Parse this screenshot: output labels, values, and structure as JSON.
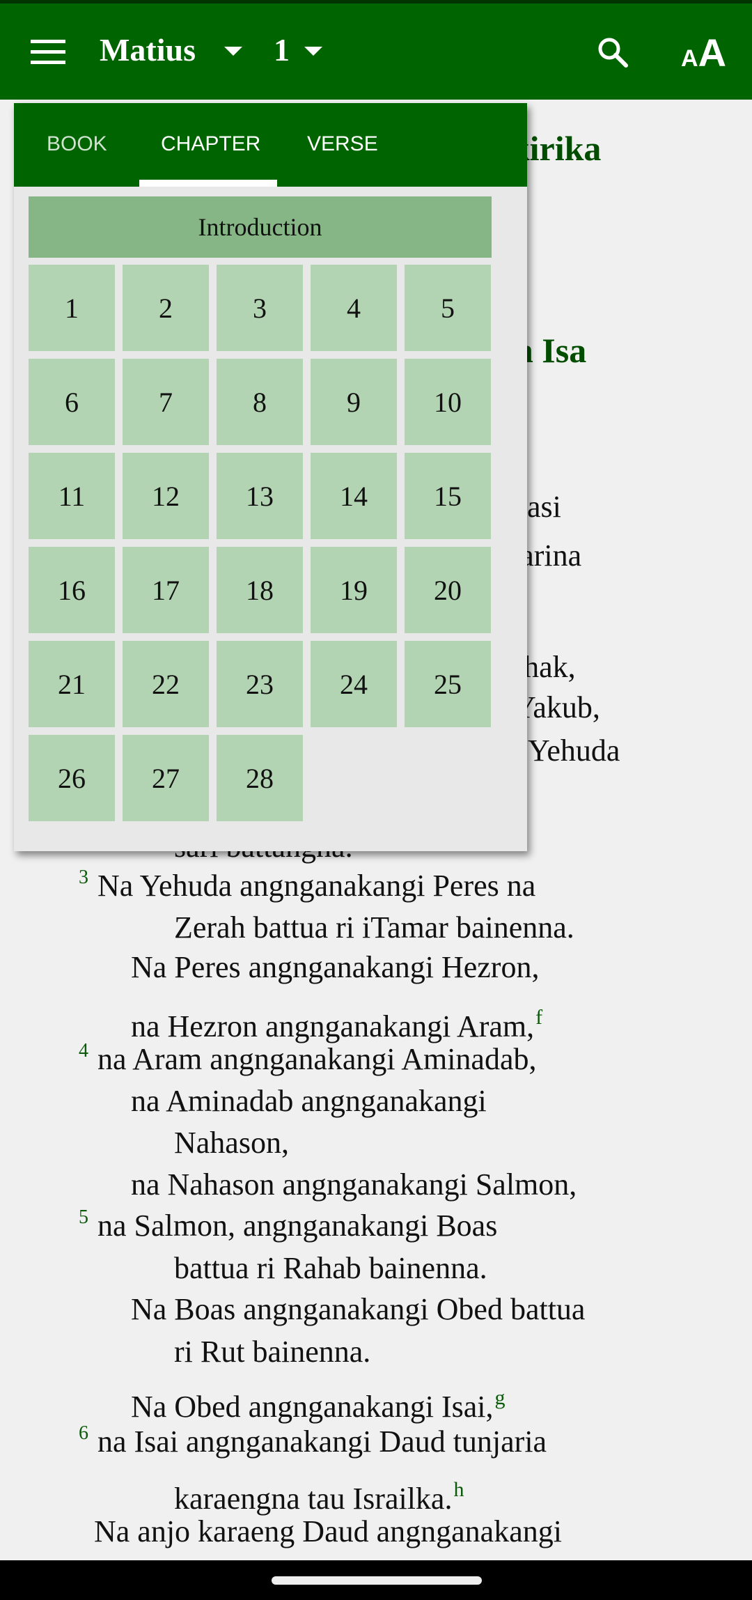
{
  "app_bar": {
    "book": "Matius",
    "chapter": "1",
    "search_icon": "search-icon",
    "text_size_icon": "text-size-icon",
    "text_size_label": "AA"
  },
  "background_fragments": {
    "heading1": "ukirika",
    "heading2a": "a",
    "heading2b": "n Isa",
    "l1": "nasi",
    "l2": "jarina",
    "l3": "shak,",
    "l4": "Yakub,",
    "l5": "Yehuda",
    "l6": "sari battangna."
  },
  "picker": {
    "tabs": [
      {
        "label": "BOOK"
      },
      {
        "label": "CHAPTER"
      },
      {
        "label": "VERSE"
      }
    ],
    "active_tab": "CHAPTER",
    "introduction": "Introduction",
    "chapters": [
      "1",
      "2",
      "3",
      "4",
      "5",
      "6",
      "7",
      "8",
      "9",
      "10",
      "11",
      "12",
      "13",
      "14",
      "15",
      "16",
      "17",
      "18",
      "19",
      "20",
      "21",
      "22",
      "23",
      "24",
      "25",
      "26",
      "27",
      "28"
    ]
  },
  "verses": [
    {
      "num": "3",
      "text": "Na Yehuda angnganakangi Peres na",
      "fn": "",
      "indent": 0
    },
    {
      "num": "",
      "text": "Zerah battua ri iTamar bainenna.",
      "fn": "",
      "indent": 2
    },
    {
      "num": "",
      "text": "Na Peres angnganakangi Hezron,",
      "fn": "",
      "indent": 1
    },
    {
      "num": "",
      "text": "na Hezron angnganakangi Aram,",
      "fn": "f",
      "indent": 1
    },
    {
      "num": "4",
      "text": "na Aram angnganakangi Aminadab,",
      "fn": "",
      "indent": 0
    },
    {
      "num": "",
      "text": "na Aminadab angnganakangi",
      "fn": "",
      "indent": 1
    },
    {
      "num": "",
      "text": "Nahason,",
      "fn": "",
      "indent": 2
    },
    {
      "num": "",
      "text": "na Nahason angnganakangi Salmon,",
      "fn": "",
      "indent": 1
    },
    {
      "num": "5",
      "text": "na Salmon, angnganakangi Boas",
      "fn": "",
      "indent": 0
    },
    {
      "num": "",
      "text": "battua ri Rahab bainenna.",
      "fn": "",
      "indent": 2
    },
    {
      "num": "",
      "text": "Na Boas angnganakangi Obed battua",
      "fn": "",
      "indent": 1
    },
    {
      "num": "",
      "text": "ri Rut bainenna.",
      "fn": "",
      "indent": 2
    },
    {
      "num": "",
      "text": "Na Obed angnganakangi Isai,",
      "fn": "g",
      "indent": 1
    },
    {
      "num": "6",
      "text": "na Isai angnganakangi Daud tunjaria",
      "fn": "",
      "indent": 0
    },
    {
      "num": "",
      "text": "karaengna tau Israilka.",
      "fn": "h",
      "indent": 2
    },
    {
      "num": "",
      "text": "Na anjo karaeng Daud angnganakangi",
      "fn": "",
      "indent": 3
    }
  ],
  "colors": {
    "primary": "#006400",
    "intro_cell": "#86b686",
    "chapter_cell": "#b3d4b3",
    "verse_number": "#0a5a0a"
  }
}
